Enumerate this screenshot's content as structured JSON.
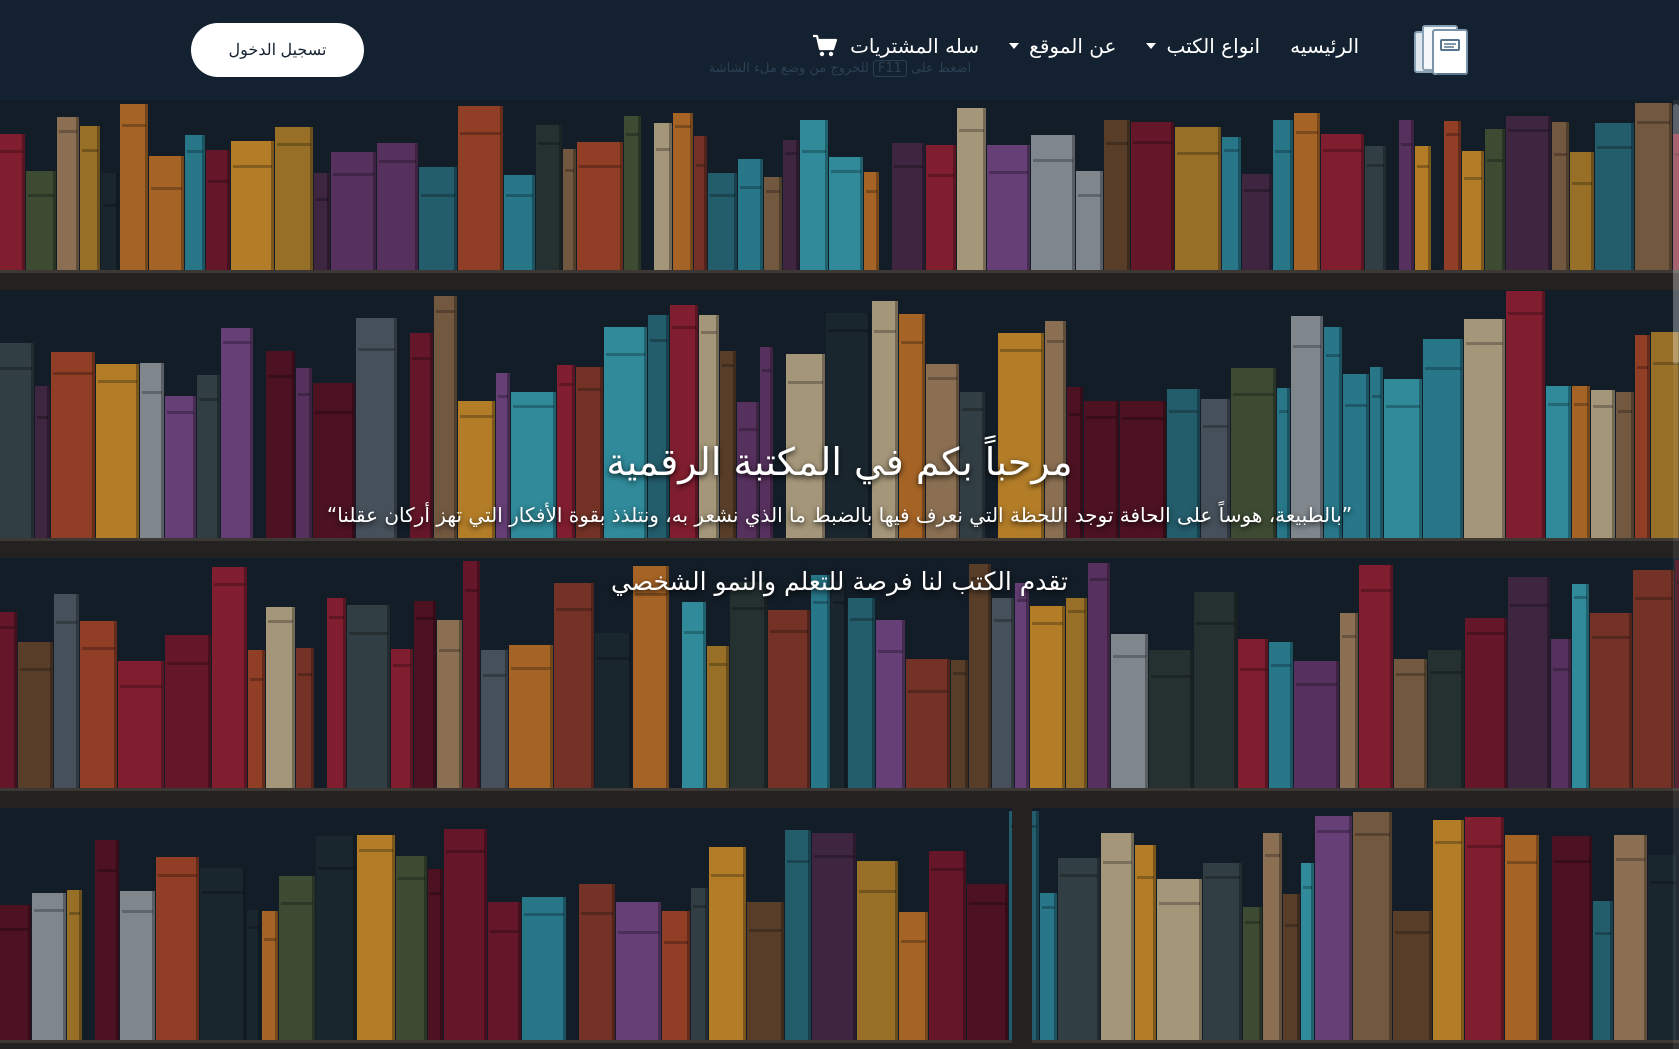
{
  "navbar": {
    "logo_icon": "book-stack-icon",
    "home_label": "الرئيسيه",
    "book_types_label": "انواع الكتب",
    "about_label": "عن الموقع",
    "cart_label": "سله المشتريات",
    "cart_icon": "shopping-cart-icon",
    "login_label": "تسجيل الدخول",
    "fullscreen_hint": {
      "before": "اضغط على",
      "key": "F11",
      "after": "للخروج من وضع ملء الشاشة"
    }
  },
  "hero": {
    "background": "bookshelf-image",
    "title": "مرحباً بكم في المكتبة الرقمية",
    "quote": "”بالطبيعة، هوساً على الحافة توجد اللحظة التي نعرف فيها بالضبط ما الذي نشعر به، ونتلذذ بقوة الأفكار التي تهز أركان عقلنا“",
    "subtitle": "تقدم الكتب لنا فرصة للتعلم والنمو الشخصي"
  },
  "colors": {
    "navbar_bg": "#132130",
    "text": "#ffffff",
    "button_bg": "#ffffff",
    "button_text": "#132130"
  }
}
